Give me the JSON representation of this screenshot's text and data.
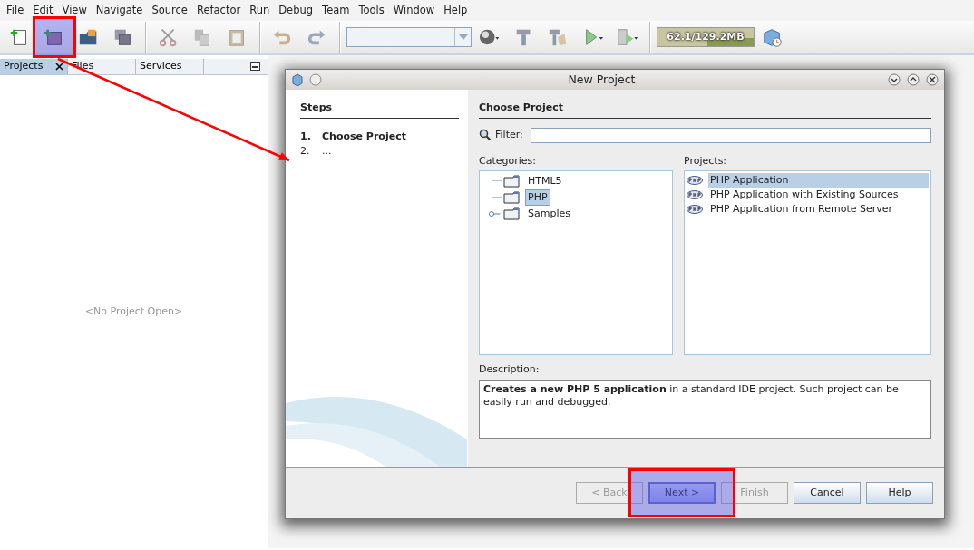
{
  "menu": [
    "File",
    "Edit",
    "View",
    "Navigate",
    "Source",
    "Refactor",
    "Run",
    "Debug",
    "Team",
    "Tools",
    "Window",
    "Help"
  ],
  "toolbar": [
    {
      "kind": "new-file",
      "highlighted": false
    },
    {
      "kind": "new-project",
      "highlighted": true
    },
    {
      "kind": "open-project",
      "highlighted": false
    },
    {
      "kind": "save",
      "highlighted": false
    },
    {
      "kind": "separator",
      "highlighted": false
    },
    {
      "kind": "cut",
      "highlighted": false
    },
    {
      "kind": "copy",
      "highlighted": false
    },
    {
      "kind": "paste",
      "highlighted": false
    },
    {
      "kind": "separator",
      "highlighted": false
    },
    {
      "kind": "undo",
      "highlighted": false
    },
    {
      "kind": "redo",
      "highlighted": false
    },
    {
      "kind": "separator",
      "highlighted": false
    },
    {
      "kind": "combo",
      "highlighted": false
    },
    {
      "kind": "globe",
      "highlighted": false
    },
    {
      "kind": "build",
      "highlighted": false
    },
    {
      "kind": "clean-build",
      "highlighted": false
    },
    {
      "kind": "run",
      "highlighted": false
    },
    {
      "kind": "debug",
      "highlighted": false
    },
    {
      "kind": "separator",
      "highlighted": false
    },
    {
      "kind": "memory",
      "label": "62.1/129.2MB",
      "level": 0.48,
      "highlighted": false
    },
    {
      "kind": "profile",
      "highlighted": false
    }
  ],
  "side_panel": {
    "tabs": [
      {
        "label": "Projects",
        "selected": true,
        "closable": true
      },
      {
        "label": "Files",
        "selected": false,
        "closable": false
      },
      {
        "label": "Services",
        "selected": false,
        "closable": false
      }
    ],
    "empty_text": "<No Project Open>"
  },
  "dialog": {
    "title": "New Project",
    "steps_title": "Steps",
    "steps": [
      {
        "number": "1.",
        "label": "Choose Project",
        "current": true
      },
      {
        "number": "2.",
        "label": "...",
        "current": false
      }
    ],
    "heading": "Choose Project",
    "filter_label": "Filter:",
    "categories_label": "Categories:",
    "categories": [
      {
        "label": "HTML5",
        "selected": false,
        "expandable": false
      },
      {
        "label": "PHP",
        "selected": true,
        "expandable": false
      },
      {
        "label": "Samples",
        "selected": false,
        "expandable": true
      }
    ],
    "projects_label": "Projects:",
    "projects": [
      {
        "label": "PHP Application",
        "selected": true
      },
      {
        "label": "PHP Application with Existing Sources",
        "selected": false
      },
      {
        "label": "PHP Application from Remote Server",
        "selected": false
      }
    ],
    "description_label": "Description:",
    "description": "**Creates a new PHP 5 application** in a standard IDE project. Such project can be easily run and debugged.",
    "buttons": [
      {
        "label": "< Back",
        "disabled": true,
        "default": false,
        "highlighted": false
      },
      {
        "label": "Next >",
        "disabled": false,
        "default": true,
        "highlighted": true
      },
      {
        "label": "Finish",
        "disabled": true,
        "default": false,
        "highlighted": false
      },
      {
        "label": "Cancel",
        "disabled": false,
        "default": false,
        "highlighted": false
      },
      {
        "label": "Help",
        "disabled": false,
        "default": false,
        "highlighted": false
      }
    ]
  }
}
